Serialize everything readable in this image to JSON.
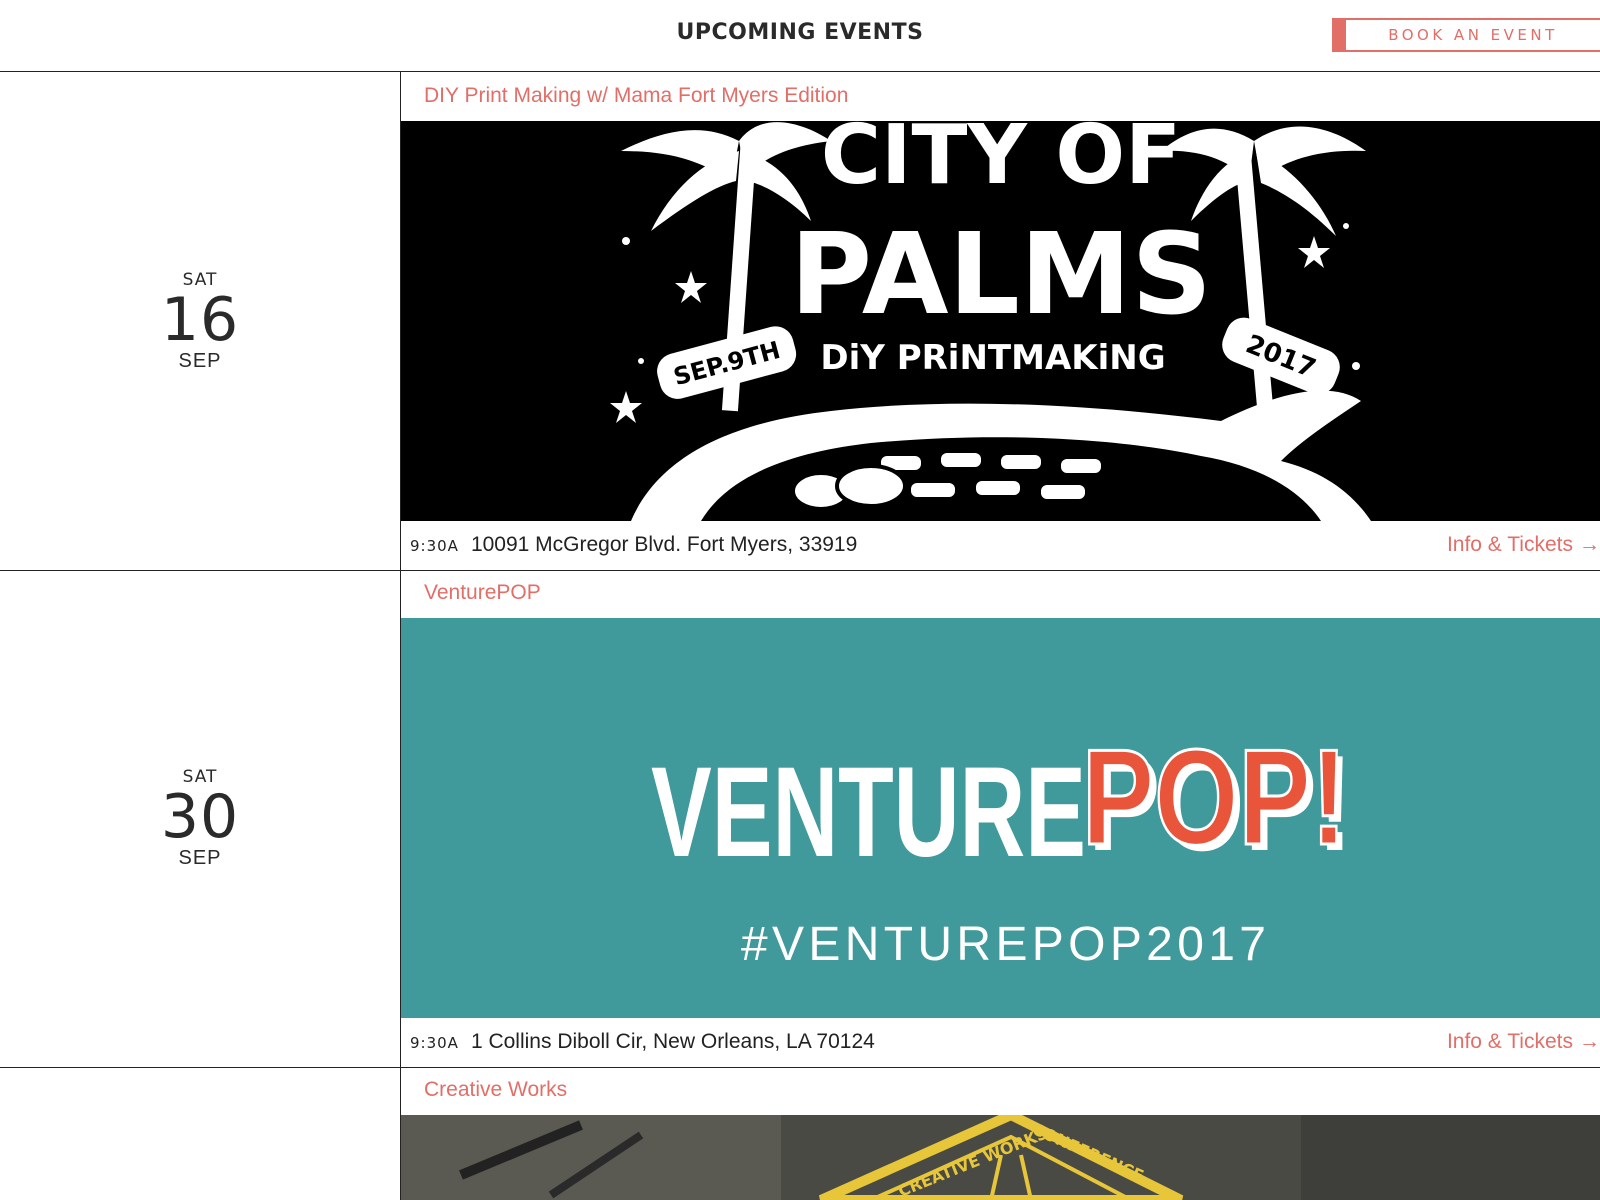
{
  "header": {
    "title": "UPCOMING EVENTS",
    "book_label": "BOOK AN EVENT"
  },
  "events": [
    {
      "dow": "SAT",
      "day": "16",
      "month": "SEP",
      "title": "DIY Print Making w/ Mama Fort Myers Edition",
      "time": "9:30A",
      "address": "10091 McGregor Blvd. Fort Myers, 33919",
      "link": "Info & Tickets",
      "banner": {
        "bg": "#000000",
        "line1": "CITY OF",
        "line2": "PALMS",
        "line3": "DiY PRiNTMAKiNG",
        "ribbon_left": "SEP.9TH",
        "ribbon_right": "2017"
      }
    },
    {
      "dow": "SAT",
      "day": "30",
      "month": "SEP",
      "title": "VenturePOP",
      "time": "9:30A",
      "address": "1 Collins Diboll Cir, New Orleans, LA 70124",
      "link": "Info & Tickets",
      "banner": {
        "bg": "#40999a",
        "word1": "VENTURE",
        "word2": "POP!",
        "hashtag": "#VENTUREPOP2017",
        "accent": "#e8553a"
      }
    },
    {
      "title": "Creative Works",
      "banner": {
        "bg": "#4a4a44",
        "badge_left": "CREATIVE WORKS",
        "badge_right": "CONFERENCE",
        "accent": "#e7c63a"
      }
    }
  ],
  "colors": {
    "accent": "#e26e68",
    "text": "#222222"
  },
  "icons": {
    "arrow": "right-arrow-icon"
  }
}
